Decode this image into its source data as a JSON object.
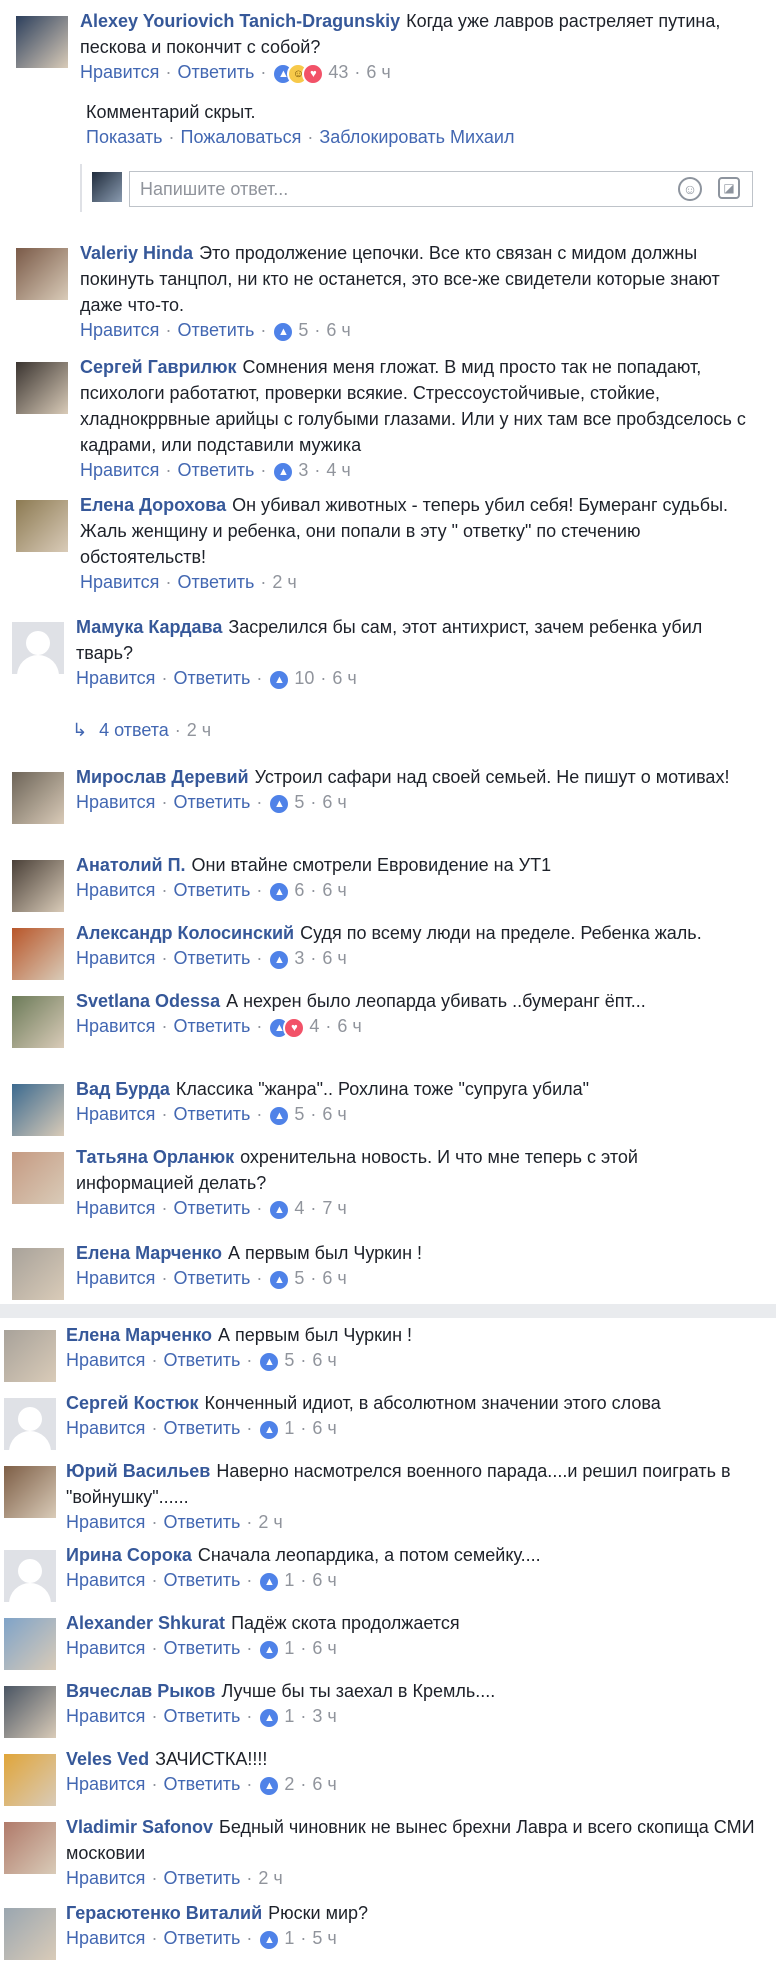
{
  "labels": {
    "like": "Нравится",
    "reply": "Ответить",
    "dot": "·"
  },
  "hidden": {
    "text": "Комментарий скрыт.",
    "show": "Показать",
    "report": "Пожаловаться",
    "block": "Заблокировать Михаил"
  },
  "reply_input": {
    "placeholder": "Напишите ответ..."
  },
  "replies_link": {
    "label": "4 ответа",
    "time": "2 ч"
  },
  "comments_a": [
    {
      "author": "Alexey Youriovich Tanich-Dragunskiy",
      "text": "Когда уже лавров растреляет путина, пескова и покончит с собой?",
      "reactions": [
        "like",
        "haha",
        "heart"
      ],
      "count": "43",
      "time": "6 ч",
      "avatar_color": "#2c3f5c"
    },
    {
      "author": "Valeriy Hinda",
      "text": "Это продолжение цепочки. Все кто связан с мидом должны покинуть танцпол, ни кто не останется, это все-же свидетели которые знают даже что-то.",
      "reactions": [
        "like"
      ],
      "count": "5",
      "time": "6 ч",
      "avatar_color": "#7a5a48"
    },
    {
      "author": "Сергей Гаврилюк",
      "text": "Сомнения меня гложат. В мид просто так не попадают, психологи работатют, проверки всякие. Стрессоустойчивые, стойкие, хладнокррвные арийцы с голубыми глазами. Или у них там все пробздселось с кадрами, или подставили мужика",
      "reactions": [
        "like"
      ],
      "count": "3",
      "time": "4 ч",
      "avatar_color": "#3a3430"
    },
    {
      "author": "Елена Дорохова",
      "text": "Он убивал животных - теперь убил себя! Бумеранг судьбы. Жаль женщину и ребенка, они попали в эту \" ответку\" по стечению обстоятельств!",
      "reactions": [],
      "count": "",
      "time": "2 ч",
      "avatar_color": "#8c7a52"
    },
    {
      "author": "Мамука Кардава",
      "text": "Засрелился бы сам, этот антихрист, зачем ребенка убил тварь?",
      "reactions": [
        "like"
      ],
      "count": "10",
      "time": "6 ч",
      "avatar_color": ""
    },
    {
      "author": "Мирослав Деревий",
      "text": "Устроил сафари над своей семьей. Не пишут о мотивах!",
      "reactions": [
        "like"
      ],
      "count": "5",
      "time": "6 ч",
      "avatar_color": "#6d6458"
    },
    {
      "author": "Анатолий П.",
      "text": "Они втайне смотрели Евровидение на УТ1",
      "reactions": [
        "like"
      ],
      "count": "6",
      "time": "6 ч",
      "avatar_color": "#4a4038"
    },
    {
      "author": "Александр Колосинский",
      "text": "Судя по всему люди на пределе. Ребенка жаль.",
      "reactions": [
        "like"
      ],
      "count": "3",
      "time": "6 ч",
      "avatar_color": "#b8562a"
    },
    {
      "author": "Svetlana Odessa",
      "text": "А нехрен было леопарда убивать ..бумеранг ёпт...",
      "reactions": [
        "like",
        "heart"
      ],
      "count": "4",
      "time": "6 ч",
      "avatar_color": "#6c7b59"
    },
    {
      "author": "Вад Бурда",
      "text": "Классика \"жанра\".. Рохлина тоже \"супруга убила\"",
      "reactions": [
        "like"
      ],
      "count": "5",
      "time": "6 ч",
      "avatar_color": "#3c6a8f"
    },
    {
      "author": "Татьяна Орланюк",
      "text": "охренительна новость. И что мне теперь с этой информацией делать?",
      "reactions": [
        "like"
      ],
      "count": "4",
      "time": "7 ч",
      "avatar_color": "#c59a82"
    },
    {
      "author": "Елена Марченко",
      "text": "А первым был Чуркин !",
      "reactions": [
        "like"
      ],
      "count": "5",
      "time": "6 ч",
      "avatar_color": "#a8a29a"
    }
  ],
  "comments_b": [
    {
      "author": "Елена Марченко",
      "text": "А первым был Чуркин !",
      "reactions": [
        "like"
      ],
      "count": "5",
      "time": "6 ч",
      "avatar_color": "#a8a29a"
    },
    {
      "author": "Сергей Костюк",
      "text": "Конченный идиот, в абсолютном значении этого слова",
      "reactions": [
        "like"
      ],
      "count": "1",
      "time": "6 ч",
      "avatar_color": ""
    },
    {
      "author": "Юрий Васильев",
      "text": "Наверно насмотрелся военного парада....и решил поиграть в \"войнушку\"......",
      "reactions": [],
      "count": "",
      "time": "2 ч",
      "avatar_color": "#7d5e46"
    },
    {
      "author": "Ирина Сорока",
      "text": "Сначала леопардика, а потом семейку....",
      "reactions": [
        "like"
      ],
      "count": "1",
      "time": "6 ч",
      "avatar_color": ""
    },
    {
      "author": "Alexander Shkurat",
      "text": "Падёж скота продолжается",
      "reactions": [
        "like"
      ],
      "count": "1",
      "time": "6 ч",
      "avatar_color": "#7fa3c8"
    },
    {
      "author": "Вячеслав Рыков",
      "text": "Лучше бы ты заехал в Кремль....",
      "reactions": [
        "like"
      ],
      "count": "1",
      "time": "3 ч",
      "avatar_color": "#4a5563"
    },
    {
      "author": "Veles Ved",
      "text": "ЗАЧИСТКА!!!!",
      "reactions": [
        "like"
      ],
      "count": "2",
      "time": "6 ч",
      "avatar_color": "#e0a53a"
    },
    {
      "author": "Vladimir Safonov",
      "text": "Бедный чиновник не вынес брехни Лавра и всего скопища СМИ московии",
      "reactions": [],
      "count": "",
      "time": "2 ч",
      "avatar_color": "#b07a6a"
    },
    {
      "author": "Герасютенко Виталий",
      "text": "Рюски мир?",
      "reactions": [
        "like"
      ],
      "count": "1",
      "time": "5 ч",
      "avatar_color": "#9aa6b0"
    }
  ]
}
